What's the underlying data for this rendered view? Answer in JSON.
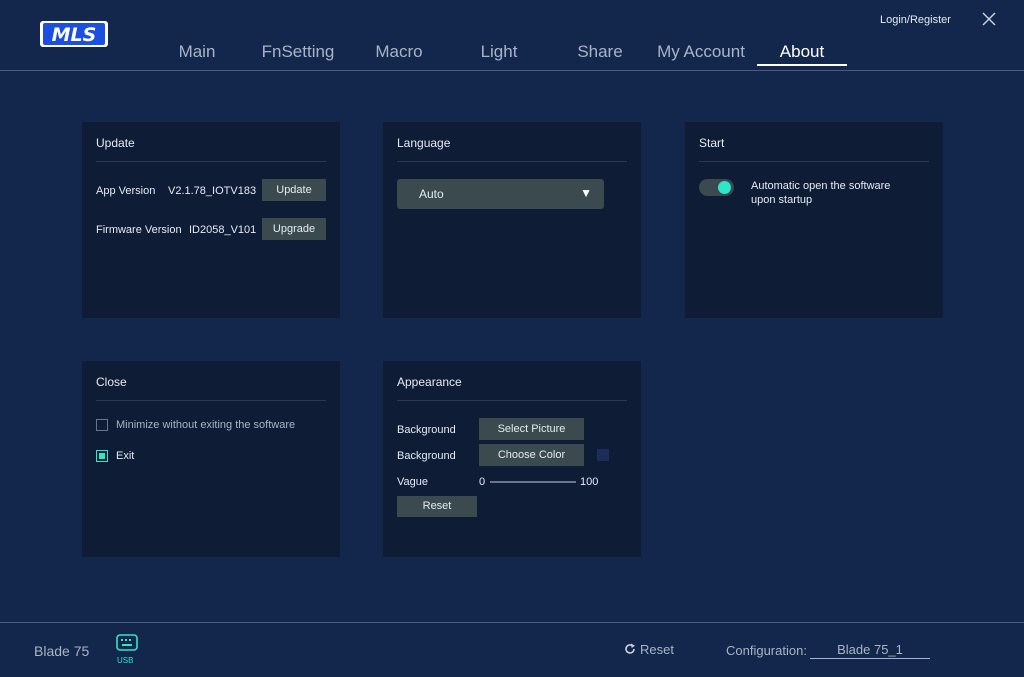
{
  "app": {
    "logo_text": "MLS",
    "login_label": "Login/Register"
  },
  "nav": {
    "tabs": [
      {
        "label": "Main"
      },
      {
        "label": "FnSetting"
      },
      {
        "label": "Macro"
      },
      {
        "label": "Light"
      },
      {
        "label": "Share"
      },
      {
        "label": "My Account"
      },
      {
        "label": "About"
      }
    ],
    "active_tab": "About"
  },
  "update": {
    "title": "Update",
    "app_version_label": "App Version",
    "app_version_value": "V2.1.78_IOTV183",
    "update_button": "Update",
    "firmware_version_label": "Firmware Version",
    "firmware_version_value": "ID2058_V101",
    "upgrade_button": "Upgrade"
  },
  "language": {
    "title": "Language",
    "selected": "Auto"
  },
  "start": {
    "title": "Start",
    "auto_open_label_line1": "Automatic open the software",
    "auto_open_label_line2": "upon startup",
    "auto_open_enabled": true
  },
  "close": {
    "title": "Close",
    "minimize_label": "Minimize without exiting the software",
    "minimize_checked": false,
    "exit_label": "Exit",
    "exit_checked": true
  },
  "appearance": {
    "title": "Appearance",
    "background_label_1": "Background",
    "select_picture_button": "Select Picture",
    "background_label_2": "Background",
    "choose_color_button": "Choose Color",
    "vague_label": "Vague",
    "vague_min": "0",
    "vague_max": "100",
    "reset_button": "Reset",
    "swatch_color": "#1c2d58"
  },
  "footer": {
    "device_name": "Blade 75",
    "usb_label": "USB",
    "reset_label": "Reset",
    "configuration_label": "Configuration:",
    "configuration_value": "Blade 75_1"
  },
  "colors": {
    "background": "#13264b",
    "card": "#0f1c36",
    "accent": "#2ee6c8",
    "button": "#3a4a4e"
  }
}
